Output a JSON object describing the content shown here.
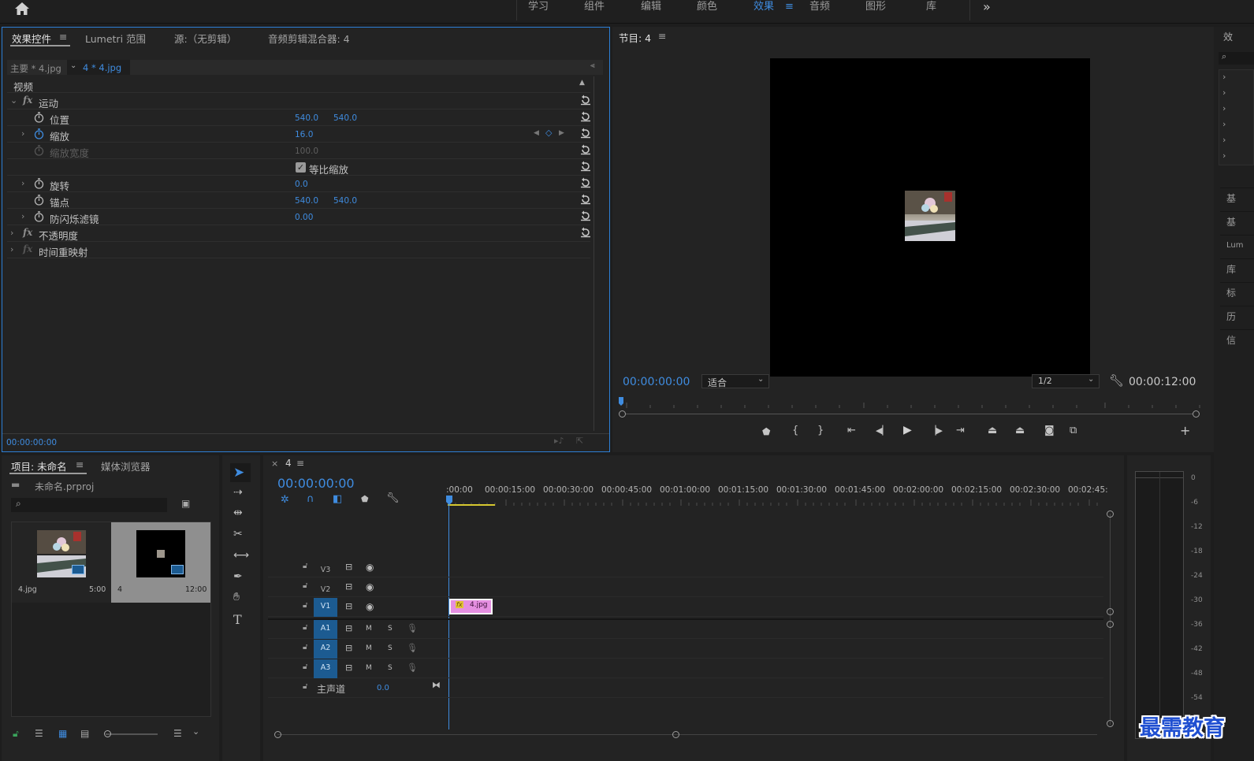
{
  "topbar": {
    "workspaces": [
      "学习",
      "组件",
      "编辑",
      "颜色",
      "效果",
      "音频",
      "图形",
      "库"
    ],
    "more": "»"
  },
  "effect_controls": {
    "tabs": [
      "效果控件",
      "Lumetri 范围",
      "源:（无剪辑）",
      "音频剪辑混合器: 4"
    ],
    "master_clip": "主要 * 4.jpg",
    "sequence_clip": "4 * 4.jpg",
    "section_video": "视频",
    "motion": "运动",
    "position_label": "位置",
    "position_x": "540.0",
    "position_y": "540.0",
    "scale_label": "缩放",
    "scale_value": "16.0",
    "scale_width_label": "缩放宽度",
    "scale_width_value": "100.0",
    "uniform_scale_label": "等比缩放",
    "rotation_label": "旋转",
    "rotation_value": "0.0",
    "anchor_label": "锚点",
    "anchor_x": "540.0",
    "anchor_y": "540.0",
    "flicker_label": "防闪烁滤镜",
    "flicker_value": "0.00",
    "opacity": "不透明度",
    "time_remap": "时间重映射",
    "timecode": "00:00:00:00"
  },
  "program_monitor": {
    "title": "节目: 4",
    "timecode": "00:00:00:00",
    "zoom": "适合",
    "resolution": "1/2",
    "duration": "00:00:12:00"
  },
  "project": {
    "tabs": [
      "项目: 未命名",
      "媒体浏览器"
    ],
    "filename": "未命名.prproj",
    "search_placeholder": "",
    "items": [
      {
        "name": "4.jpg",
        "duration": "5:00"
      },
      {
        "name": "4",
        "duration": "12:00"
      }
    ]
  },
  "timeline": {
    "close": "×",
    "sequence": "4",
    "timecode": "00:00:00:00",
    "ruler": [
      ":00:00",
      "00:00:15:00",
      "00:00:30:00",
      "00:00:45:00",
      "00:01:00:00",
      "00:01:15:00",
      "00:01:30:00",
      "00:01:45:00",
      "00:02:00:00",
      "00:02:15:00",
      "00:02:30:00",
      "00:02:45:"
    ],
    "video_tracks": [
      "V3",
      "V2",
      "V1"
    ],
    "audio_tracks": [
      "A1",
      "A2",
      "A3"
    ],
    "mute": "M",
    "solo": "S",
    "master_label": "主声道",
    "master_value": "0.0",
    "clip_label": "4.jpg",
    "clip_fx": "fx"
  },
  "audio_meter": {
    "db_labels": [
      "0",
      "-6",
      "-12",
      "-18",
      "-24",
      "-30",
      "-36",
      "-42",
      "-48",
      "-54"
    ]
  },
  "right_panel": {
    "title": "效",
    "items": [
      "基",
      "基",
      "Lum",
      "库",
      "标",
      "历",
      "信"
    ]
  },
  "watermark": "最需教育",
  "colors": {
    "accent": "#3f8ce0",
    "clip_pink": "#e58fe1",
    "track_selected": "#1c5b91",
    "playhead": "#3f8ce0",
    "work_area": "#d6c830"
  }
}
